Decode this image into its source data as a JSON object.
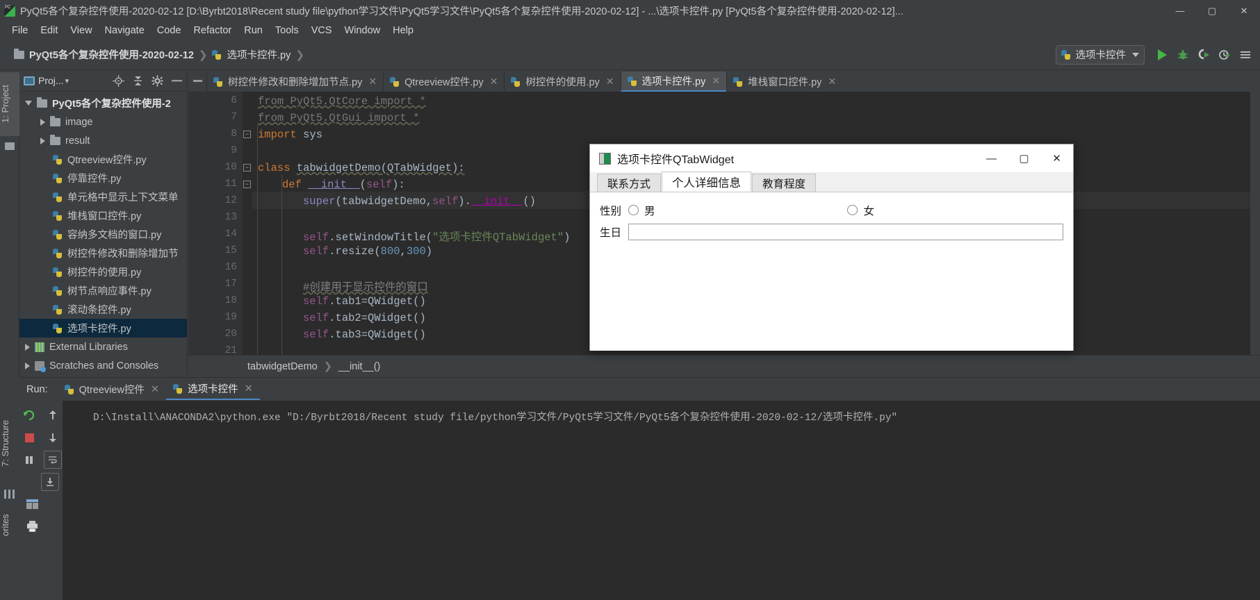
{
  "window": {
    "title": "PyQt5各个复杂控件使用-2020-02-12 [D:\\Byrbt2018\\Recent study file\\python学习文件\\PyQt5学习文件\\PyQt5各个复杂控件使用-2020-02-12] - ...\\选项卡控件.py [PyQt5各个复杂控件使用-2020-02-12]...",
    "app_icon": "pycharm-icon",
    "buttons": {
      "minimize": "—",
      "maximize": "▢",
      "close": "✕"
    }
  },
  "menubar": {
    "items": [
      {
        "label": "File"
      },
      {
        "label": "Edit"
      },
      {
        "label": "View"
      },
      {
        "label": "Navigate"
      },
      {
        "label": "Code"
      },
      {
        "label": "Refactor"
      },
      {
        "label": "Run"
      },
      {
        "label": "Tools"
      },
      {
        "label": "VCS"
      },
      {
        "label": "Window"
      },
      {
        "label": "Help"
      }
    ]
  },
  "breadcrumb": {
    "project": "PyQt5各个复杂控件使用-2020-02-12",
    "file": "选项卡控件.py",
    "separator": "❯"
  },
  "toolbar": {
    "run_config": "选项卡控件",
    "run_config_caret": "▼",
    "icons": [
      "run-icon",
      "debug-icon",
      "run-coverage-icon",
      "profile-icon",
      "more-icon"
    ]
  },
  "left_strip": {
    "project_tab": "1: Project",
    "structure_tab": "7: Structure",
    "favorites_tab": "orites"
  },
  "project_panel": {
    "header_label": "Proj...",
    "header_caret": "▾",
    "header_icons": [
      "locate-icon",
      "collapse-all-icon",
      "settings-gear-icon",
      "hide-icon"
    ],
    "tree": [
      {
        "label": "PyQt5各个复杂控件使用-2",
        "arrow": "down",
        "indent": 1,
        "icon": "folder-icon",
        "bold": true,
        "selected": false
      },
      {
        "label": "image",
        "arrow": "right",
        "indent": 2,
        "icon": "folder-icon",
        "bold": false,
        "selected": false
      },
      {
        "label": "result",
        "arrow": "right",
        "indent": 2,
        "icon": "folder-icon",
        "bold": false,
        "selected": false
      },
      {
        "label": "Qtreeview控件.py",
        "arrow": "none",
        "indent": 3,
        "icon": "python-file-icon",
        "bold": false,
        "selected": false
      },
      {
        "label": "停靠控件.py",
        "arrow": "none",
        "indent": 3,
        "icon": "python-file-icon",
        "bold": false,
        "selected": false
      },
      {
        "label": "单元格中显示上下文菜单",
        "arrow": "none",
        "indent": 3,
        "icon": "python-file-icon",
        "bold": false,
        "selected": false
      },
      {
        "label": "堆栈窗口控件.py",
        "arrow": "none",
        "indent": 3,
        "icon": "python-file-icon",
        "bold": false,
        "selected": false
      },
      {
        "label": "容纳多文档的窗口.py",
        "arrow": "none",
        "indent": 3,
        "icon": "python-file-icon",
        "bold": false,
        "selected": false
      },
      {
        "label": "树控件修改和删除增加节",
        "arrow": "none",
        "indent": 3,
        "icon": "python-file-icon",
        "bold": false,
        "selected": false
      },
      {
        "label": "树控件的使用.py",
        "arrow": "none",
        "indent": 3,
        "icon": "python-file-icon",
        "bold": false,
        "selected": false
      },
      {
        "label": "树节点响应事件.py",
        "arrow": "none",
        "indent": 3,
        "icon": "python-file-icon",
        "bold": false,
        "selected": false
      },
      {
        "label": "滚动条控件.py",
        "arrow": "none",
        "indent": 3,
        "icon": "python-file-icon",
        "bold": false,
        "selected": false
      },
      {
        "label": "选项卡控件.py",
        "arrow": "none",
        "indent": 3,
        "icon": "python-file-icon",
        "bold": false,
        "selected": true
      },
      {
        "label": "External Libraries",
        "arrow": "right",
        "indent": 1,
        "icon": "library-icon",
        "bold": false,
        "selected": false
      },
      {
        "label": "Scratches and Consoles",
        "arrow": "right",
        "indent": 1,
        "icon": "scratches-icon",
        "bold": false,
        "selected": false
      }
    ]
  },
  "editor_tabs": [
    {
      "label": "树控件修改和删除增加节点.py",
      "active": false,
      "close": "✕"
    },
    {
      "label": "Qtreeview控件.py",
      "active": false,
      "close": "✕"
    },
    {
      "label": "树控件的使用.py",
      "active": false,
      "close": "✕"
    },
    {
      "label": "选项卡控件.py",
      "active": true,
      "close": "✕"
    },
    {
      "label": "堆栈窗口控件.py",
      "active": false,
      "close": "✕"
    }
  ],
  "editor": {
    "line_numbers": [
      "6",
      "7",
      "8",
      "9",
      "10",
      "11",
      "12",
      "13",
      "14",
      "15",
      "16",
      "17",
      "18",
      "19",
      "20",
      "21"
    ],
    "lines": [
      {
        "n": "6",
        "text": "from PyQt5.QtCore import *"
      },
      {
        "n": "7",
        "text": "from PyQt5.QtGui import *"
      },
      {
        "n": "8",
        "text": "import sys"
      },
      {
        "n": "9",
        "text": ""
      },
      {
        "n": "10",
        "text": "class tabwidgetDemo(QTabWidget):"
      },
      {
        "n": "11",
        "text": "    def __init__(self):"
      },
      {
        "n": "12",
        "text": "        super(tabwidgetDemo,self).__init__()"
      },
      {
        "n": "13",
        "text": ""
      },
      {
        "n": "14",
        "text": "        self.setWindowTitle(\"选项卡控件QTabWidget\")"
      },
      {
        "n": "15",
        "text": "        self.resize(800,300)"
      },
      {
        "n": "16",
        "text": ""
      },
      {
        "n": "17",
        "text": "        #创建用于显示控件的窗口"
      },
      {
        "n": "18",
        "text": "        self.tab1=QWidget()"
      },
      {
        "n": "19",
        "text": "        self.tab2=QWidget()"
      },
      {
        "n": "20",
        "text": "        self.tab3=QWidget()"
      },
      {
        "n": "21",
        "text": ""
      }
    ],
    "tokens": {
      "import_kw": "import",
      "from_kw": "from",
      "class_kw": "class",
      "def_kw": "def",
      "qtcore_mod": "PyQt5.QtCore",
      "qtgui_mod": "PyQt5.QtGui",
      "star": "*",
      "sys_mod": "sys",
      "class_name": "tabwidgetDemo",
      "class_base": "(QTabWidget):",
      "init_name": "__init__",
      "self_kw": "self",
      "super_kw": "super",
      "set_title_call": "self.setWindowTitle(",
      "title_str": "\"选项卡控件QTabWidget\"",
      "resize_call": "self.resize(",
      "resize_w": "800",
      "resize_h": "300",
      "comment": "#创建用于显示控件的窗口",
      "tab1": "self.tab1=QWidget()",
      "tab2": "self.tab2=QWidget()",
      "tab3": "self.tab3=QWidget()"
    }
  },
  "structure_breadcrumb": {
    "class": "tabwidgetDemo",
    "separator": "❯",
    "method": "__init__()"
  },
  "run_panel": {
    "label": "Run:",
    "tabs": [
      {
        "label": "Qtreeview控件",
        "active": false,
        "close": "✕"
      },
      {
        "label": "选项卡控件",
        "active": true,
        "close": "✕"
      }
    ],
    "side_icons": [
      "rerun-icon",
      "stop-icon",
      "pause-icon",
      "up-stack-icon",
      "down-stack-icon",
      "soft-wrap-icon",
      "scroll-to-end-icon",
      "print-icon"
    ],
    "console_output": "D:\\Install\\ANACONDA2\\python.exe \"D:/Byrbt2018/Recent study file/python学习文件/PyQt5学习文件/PyQt5各个复杂控件使用-2020-02-12/选项卡控件.py\""
  },
  "qt_dialog": {
    "title": "选项卡控件QTabWidget",
    "icon": "qt-window-icon",
    "buttons": {
      "minimize": "—",
      "maximize": "▢",
      "close": "✕"
    },
    "tabs": [
      {
        "label": "联系方式",
        "active": false
      },
      {
        "label": "个人详细信息",
        "active": true
      },
      {
        "label": "教育程度",
        "active": false
      }
    ],
    "form": {
      "gender_label": "性别",
      "male_label": "男",
      "female_label": "女",
      "birthday_label": "生日",
      "birthday_value": "",
      "birthday_placeholder": ""
    }
  }
}
